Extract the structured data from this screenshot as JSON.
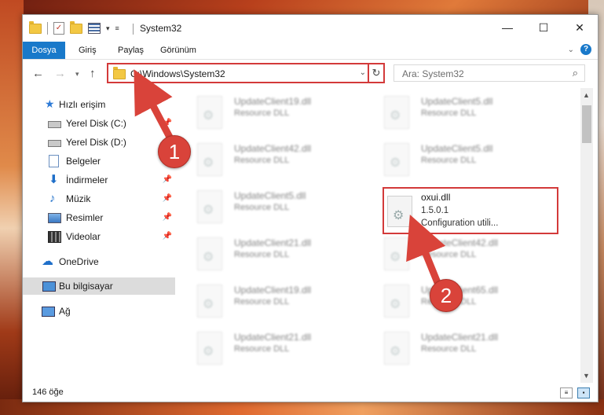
{
  "window": {
    "title": "System32"
  },
  "ribbon": {
    "tabs": [
      "Dosya",
      "Giriş",
      "Paylaş",
      "Görünüm"
    ],
    "help": "?"
  },
  "address": {
    "path": "C:\\Windows\\System32"
  },
  "search": {
    "placeholder": "Ara: System32"
  },
  "sidebar": {
    "items": [
      {
        "label": "Hızlı erişim"
      },
      {
        "label": "Yerel Disk (C:)"
      },
      {
        "label": "Yerel Disk (D:)"
      },
      {
        "label": "Belgeler"
      },
      {
        "label": "İndirmeler"
      },
      {
        "label": "Müzik"
      },
      {
        "label": "Resimler"
      },
      {
        "label": "Videolar"
      },
      {
        "label": "OneDrive"
      },
      {
        "label": "Bu bilgisayar"
      },
      {
        "label": "Ağ"
      }
    ]
  },
  "files": [
    {
      "name": "UpdateClient19.dll",
      "desc": "Resource DLL"
    },
    {
      "name": "UpdateClient5.dll",
      "desc": "Resource DLL"
    },
    {
      "name": "UpdateClient42.dll",
      "desc": "Resource DLL"
    },
    {
      "name": "UpdateClient5.dll",
      "desc": "Resource DLL"
    },
    {
      "name": "UpdateClient5.dll",
      "desc": "Resource DLL"
    },
    {
      "name": "UpdateClient21.dll",
      "desc": "Resource DLL"
    },
    {
      "name": "UpdateClient42.dll",
      "desc": "Resource DLL"
    },
    {
      "name": "UpdateClient19.dll",
      "desc": "Resource DLL"
    },
    {
      "name": "UpdateClient65.dll",
      "desc": "Resource DLL"
    },
    {
      "name": "UpdateClient21.dll",
      "desc": "Resource DLL"
    },
    {
      "name": "UpdateClient21.dll",
      "desc": "Resource DLL"
    }
  ],
  "highlighted_file": {
    "name": "oxui.dll",
    "version": "1.5.0.1",
    "desc": "Configuration utili..."
  },
  "status": {
    "count": "146 öğe"
  },
  "callouts": {
    "one": "1",
    "two": "2"
  },
  "colors": {
    "accent": "#1979ca",
    "highlight": "#d33a3a"
  }
}
